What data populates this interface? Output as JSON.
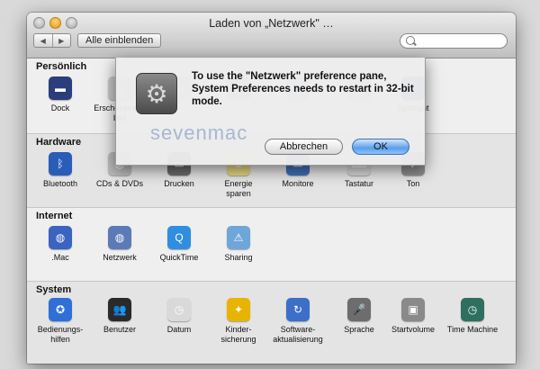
{
  "window": {
    "title": "Laden von „Netzwerk\" …",
    "nav_back": "◀",
    "nav_forward": "▶",
    "show_all_label": "Alle einblenden",
    "search_placeholder": ""
  },
  "sections": {
    "personal": {
      "title": "Persönlich",
      "items": [
        {
          "label": "Dock",
          "icon": "dock-icon",
          "color": "#2b3d7a",
          "glyph": "▬"
        },
        {
          "label": "Erscheinungs-\nbild",
          "icon": "appearance-icon",
          "color": "#c7c7c7",
          "glyph": "▤"
        },
        {
          "label": "",
          "icon": "desktop-icon",
          "color": "#6b8ec6",
          "glyph": "▦"
        },
        {
          "label": "",
          "icon": "expose-icon",
          "color": "#5a5a5a",
          "glyph": "▦"
        },
        {
          "label": "",
          "icon": "international-icon",
          "color": "#4a7cc7",
          "glyph": "⚑"
        },
        {
          "label": "",
          "icon": "security-icon",
          "color": "#9c9c9c",
          "glyph": "◉"
        },
        {
          "label": "Spotlight",
          "icon": "spotlight-icon",
          "color": "#3a6fd0",
          "glyph": "⌕"
        }
      ]
    },
    "hardware": {
      "title": "Hardware",
      "items": [
        {
          "label": "Bluetooth",
          "icon": "bluetooth-icon",
          "color": "#2a5db8",
          "glyph": "ᛒ"
        },
        {
          "label": "CDs & DVDs",
          "icon": "cd-dvd-icon",
          "color": "#b9b9b9",
          "glyph": "◎"
        },
        {
          "label": "Drucken",
          "icon": "printer-icon",
          "color": "#6a6a6a",
          "glyph": "▭"
        },
        {
          "label": "Energie\nsparen",
          "icon": "energy-saver-icon",
          "color": "#e6d680",
          "glyph": "✺"
        },
        {
          "label": "Monitore",
          "icon": "display-icon",
          "color": "#3f6fb5",
          "glyph": "▭"
        },
        {
          "label": "Tastatur",
          "icon": "keyboard-mouse-icon",
          "color": "#d7d7d7",
          "glyph": "⌨"
        },
        {
          "label": "Ton",
          "icon": "sound-icon",
          "color": "#8d8d8d",
          "glyph": "♪"
        }
      ]
    },
    "internet": {
      "title": "Internet",
      "items": [
        {
          "label": ".Mac",
          "icon": "mac-icon",
          "color": "#3b63c0",
          "glyph": "◍"
        },
        {
          "label": "Netzwerk",
          "icon": "network-icon",
          "color": "#5b7bb8",
          "glyph": "◍"
        },
        {
          "label": "QuickTime",
          "icon": "quicktime-icon",
          "color": "#2f8ee0",
          "glyph": "Q"
        },
        {
          "label": "Sharing",
          "icon": "sharing-icon",
          "color": "#6fa6da",
          "glyph": "⚠"
        }
      ]
    },
    "system": {
      "title": "System",
      "items": [
        {
          "label": "Bedienungs-\nhilfen",
          "icon": "universal-access-icon",
          "color": "#2e6fd8",
          "glyph": "✪"
        },
        {
          "label": "Benutzer",
          "icon": "accounts-icon",
          "color": "#2a2a2a",
          "glyph": "👥"
        },
        {
          "label": "Datum",
          "icon": "date-time-icon",
          "color": "#d9d9d9",
          "glyph": "◷"
        },
        {
          "label": "Kinder-\nsicherung",
          "icon": "parental-controls-icon",
          "color": "#e8b400",
          "glyph": "✦"
        },
        {
          "label": "Software-\naktualisierung",
          "icon": "software-update-icon",
          "color": "#3b6fc8",
          "glyph": "↻"
        },
        {
          "label": "Sprache",
          "icon": "speech-icon",
          "color": "#6d6d6d",
          "glyph": "🎤"
        },
        {
          "label": "Startvolume",
          "icon": "startup-disk-icon",
          "color": "#8a8a8a",
          "glyph": "▣"
        },
        {
          "label": "Time Machine",
          "icon": "time-machine-icon",
          "color": "#2f6f5f",
          "glyph": "◷"
        }
      ]
    }
  },
  "sheet": {
    "message": "To use the \"Netzwerk\" preference pane, System Preferences needs to restart in 32-bit mode.",
    "watermark": "sevenmac",
    "cancel_label": "Abbrechen",
    "ok_label": "OK"
  }
}
